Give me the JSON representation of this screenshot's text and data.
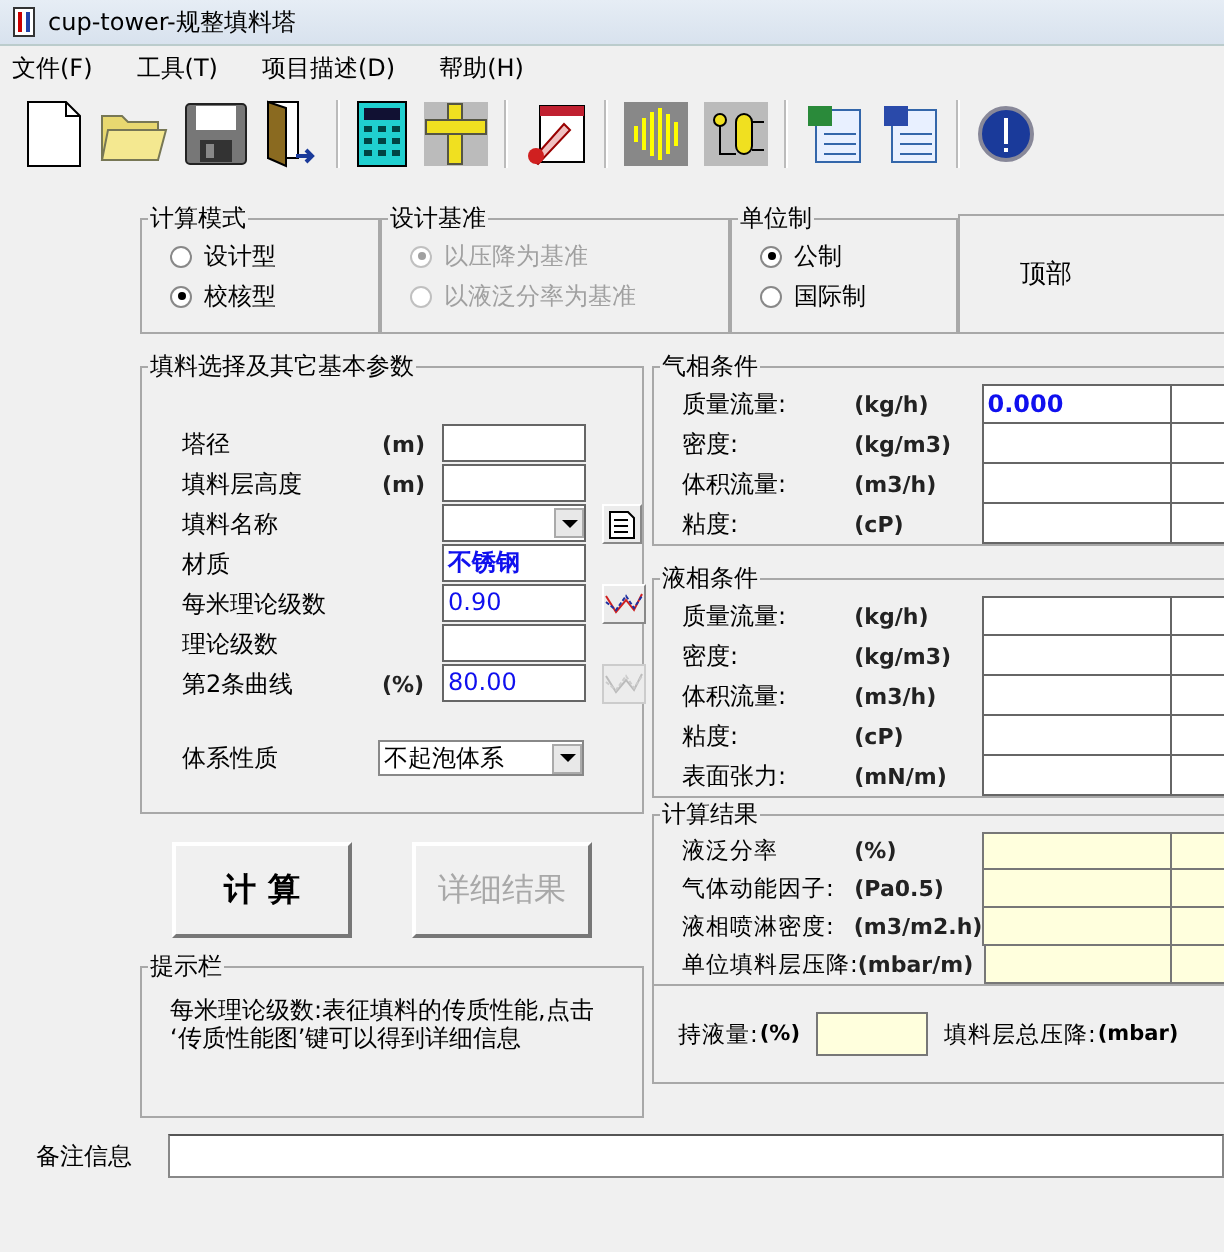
{
  "window": {
    "title": "cup-tower-规整填料塔"
  },
  "menu": [
    "文件(F)",
    "工具(T)",
    "项目描述(D)",
    "帮助(H)"
  ],
  "calc_mode": {
    "title": "计算模式",
    "disabled": false,
    "options": [
      {
        "label": "设计型",
        "selected": false
      },
      {
        "label": "校核型",
        "selected": true
      }
    ]
  },
  "design_basis": {
    "title": "设计基准",
    "disabled": true,
    "options": [
      {
        "label": "以压降为基准",
        "selected": true
      },
      {
        "label": "以液泛分率为基准",
        "selected": false
      }
    ]
  },
  "unit_system": {
    "title": "单位制",
    "disabled": false,
    "options": [
      {
        "label": "公制",
        "selected": true
      },
      {
        "label": "国际制",
        "selected": false
      }
    ]
  },
  "top_label": "顶部",
  "packing": {
    "title": "填料选择及其它基本参数",
    "fields": [
      {
        "label": "塔径",
        "unit": "(m)",
        "kind": "text"
      },
      {
        "label": "填料层高度",
        "unit": "(m)",
        "kind": "text"
      },
      {
        "label": "填料名称",
        "kind": "dropdown",
        "side_button": {
          "kind": "doc",
          "disabled": false
        }
      },
      {
        "label": "材质",
        "kind": "text",
        "value": "不锈钢",
        "bold": true
      },
      {
        "label": "每米理论级数",
        "kind": "text",
        "value": "0.90",
        "bold": false,
        "side_button": {
          "kind": "chart",
          "disabled": false
        }
      },
      {
        "label": "理论级数",
        "kind": "text"
      },
      {
        "label": "第2条曲线",
        "unit": "(%)",
        "kind": "text",
        "value": "80.00",
        "bold": false,
        "side_button": {
          "kind": "chart",
          "disabled": true
        }
      }
    ],
    "system": {
      "label": "体系性质",
      "value": "不起泡体系"
    }
  },
  "buttons": [
    {
      "label": "计 算",
      "disabled": false
    },
    {
      "label": "详细结果",
      "disabled": true
    }
  ],
  "hint": {
    "title": "提示栏",
    "text": "每米理论级数:表征填料的传质性能,点击 ‘传质性能图’键可以得到详细信息"
  },
  "gas": {
    "title": "气相条件",
    "rows": [
      {
        "label": "质量流量:",
        "unit": "(kg/h)",
        "value": "0.000"
      },
      {
        "label": "密度:",
        "unit": "(kg/m3)"
      },
      {
        "label": "体积流量:",
        "unit": "(m3/h)"
      },
      {
        "label": "粘度:",
        "unit": "(cP)"
      }
    ]
  },
  "liquid": {
    "title": "液相条件",
    "rows": [
      {
        "label": "质量流量:",
        "unit": "(kg/h)"
      },
      {
        "label": "密度:",
        "unit": "(kg/m3)"
      },
      {
        "label": "体积流量:",
        "unit": "(m3/h)"
      },
      {
        "label": "粘度:",
        "unit": "(cP)"
      },
      {
        "label": "表面张力:",
        "unit": "(mN/m)"
      }
    ]
  },
  "results": {
    "title": "计算结果",
    "rows": [
      {
        "label": "液泛分率",
        "unit": "(%)"
      },
      {
        "label": "气体动能因子:",
        "unit": "(Pa0.5)"
      },
      {
        "label": "液相喷淋密度:",
        "unit": "(m3/m2.h)"
      },
      {
        "label": "单位填料层压降:",
        "unit": "(mbar/m)"
      }
    ]
  },
  "holdup": {
    "label": "持液量:",
    "unit": "(%)"
  },
  "total_drop": {
    "label": "填料层总压降:",
    "unit": "(mbar)"
  },
  "notes": {
    "label": "备注信息"
  }
}
